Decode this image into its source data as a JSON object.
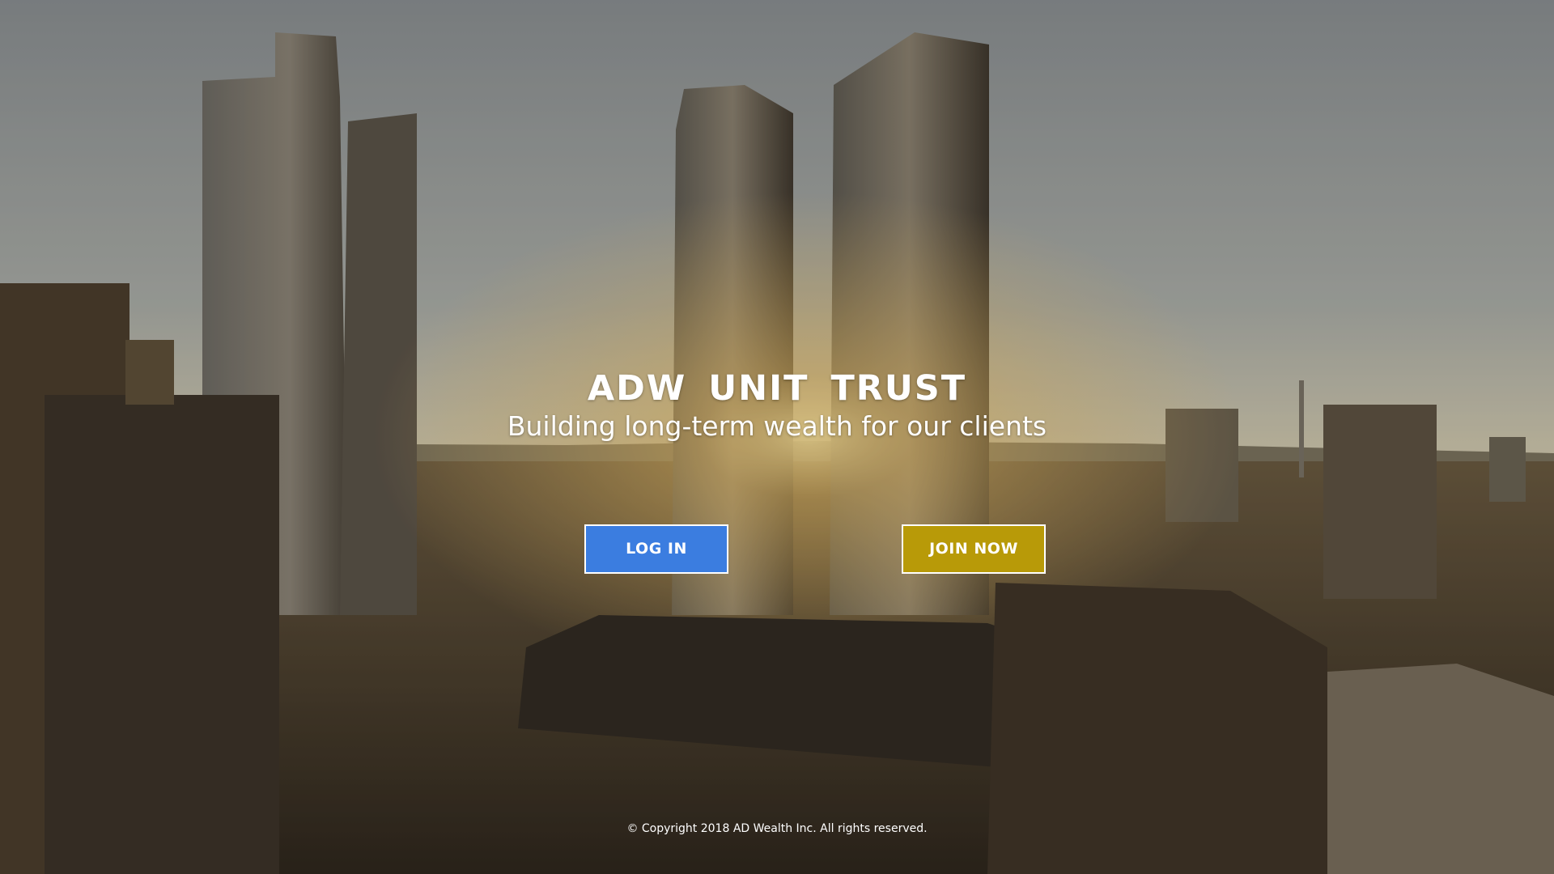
{
  "hero": {
    "title": "ADW  UNIT  TRUST",
    "subtitle": "Building long-term wealth for our clients"
  },
  "actions": {
    "login_label": "LOG IN",
    "join_label": "JOIN NOW"
  },
  "footer": {
    "copyright": "© Copyright 2018 AD Wealth Inc. All rights reserved."
  },
  "colors": {
    "login_button": "#3b7de0",
    "join_button": "#b89a08",
    "text": "#ffffff"
  }
}
